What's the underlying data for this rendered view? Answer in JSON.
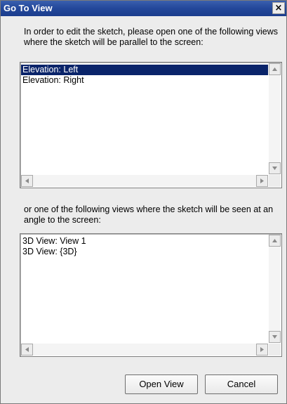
{
  "dialog": {
    "title": "Go To View",
    "close_glyph": "×"
  },
  "instructions": {
    "parallel": "In order to edit the sketch, please open one of the following views where the sketch will be parallel to the screen:",
    "angle": "or one of the following views where the sketch will be seen at an angle to the screen:"
  },
  "parallel_views": {
    "items": [
      "Elevation: Left",
      "Elevation: Right"
    ],
    "selected": "Elevation: Left"
  },
  "angle_views": {
    "items": [
      "3D View: View 1",
      "3D View: {3D}"
    ]
  },
  "buttons": {
    "open": "Open View",
    "cancel": "Cancel"
  },
  "icons": {
    "close": "close-icon",
    "scroll_up": "scroll-up-arrow-icon",
    "scroll_down": "scroll-down-arrow-icon",
    "scroll_left": "scroll-left-arrow-icon",
    "scroll_right": "scroll-right-arrow-icon"
  },
  "colors": {
    "titlebar": "#23479a",
    "selection": "#0a246a",
    "dialog_bg": "#ececec"
  }
}
